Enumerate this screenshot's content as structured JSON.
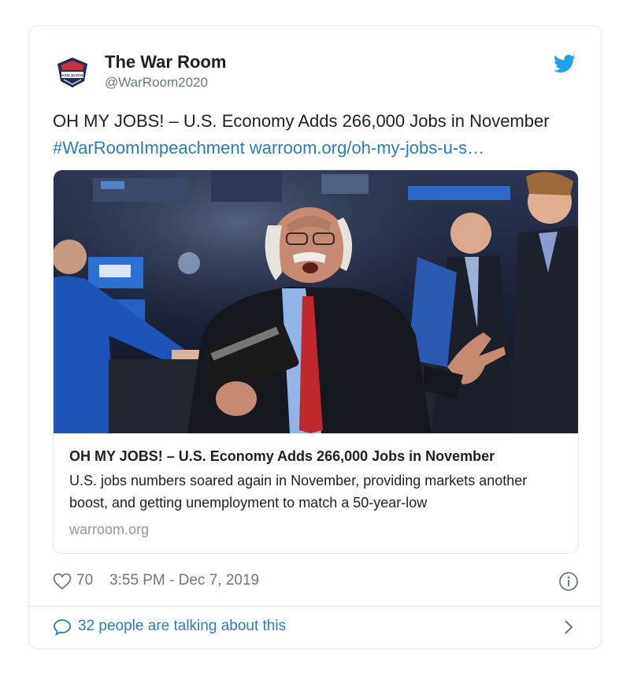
{
  "tweet": {
    "display_name": "The War Room",
    "handle": "@WarRoom2020",
    "avatar_logo_text": "WAR ROOM",
    "text": "OH MY JOBS! – U.S. Economy Adds 266,000 Jobs in November",
    "hashtag": "#WarRoomImpeachment",
    "link": "warroom.org/oh-my-jobs-u-s…"
  },
  "link_card": {
    "title": "OH MY JOBS! – U.S. Economy Adds 266,000 Jobs in November",
    "description": "U.S. jobs numbers soared again in November, providing markets another boost, and getting unemployment to match a 50-year-low",
    "domain": "warroom.org"
  },
  "meta": {
    "likes": "70",
    "timestamp": "3:55 PM - Dec 7, 2019"
  },
  "footer": {
    "talking": "32 people are talking about this"
  },
  "icons": {
    "like": "heart-icon",
    "info": "info-icon",
    "reply": "speech-bubble-icon",
    "chevron": "chevron-right-icon",
    "brand": "twitter-bird-icon"
  },
  "colors": {
    "link": "#2b7bb9",
    "muted": "#697882",
    "border": "#e1e8ed",
    "twitter_blue": "#1da1f2"
  }
}
